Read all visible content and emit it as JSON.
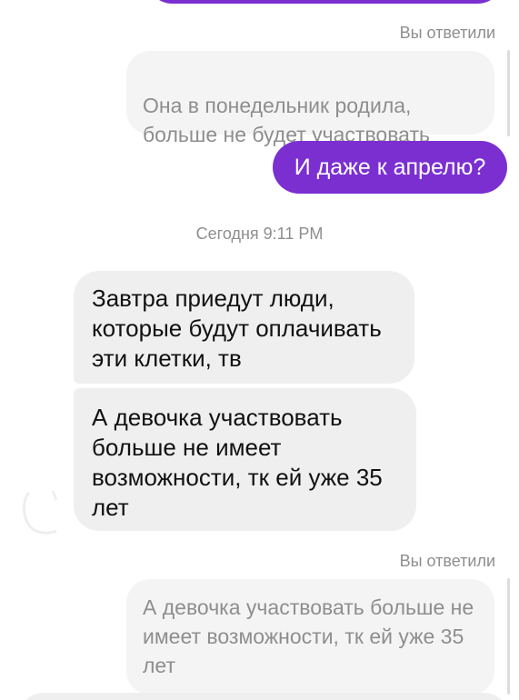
{
  "conversation": {
    "reply_label_1": "Вы ответили",
    "quoted_1": "Она в понедельник родила,\nбольше не будет участвовать",
    "sent_1": "И даже к апрелю?",
    "timestamp": "Сегодня 9:11 PM",
    "received_1": "Завтра приедут люди, которые будут оплачивать эти клетки, тв",
    "received_2": "А девочка участвовать больше не имеет возможности, тк ей уже 35 лет",
    "reply_label_2": "Вы ответили",
    "quoted_2": "А девочка участвовать больше не имеет возможности, тк ей уже 35 лет"
  },
  "colors": {
    "sent_bubble": "#7b2fd1",
    "received_bubble": "#efefef",
    "quoted_bubble": "#f4f4f4",
    "meta_text": "#8e8e8e"
  }
}
